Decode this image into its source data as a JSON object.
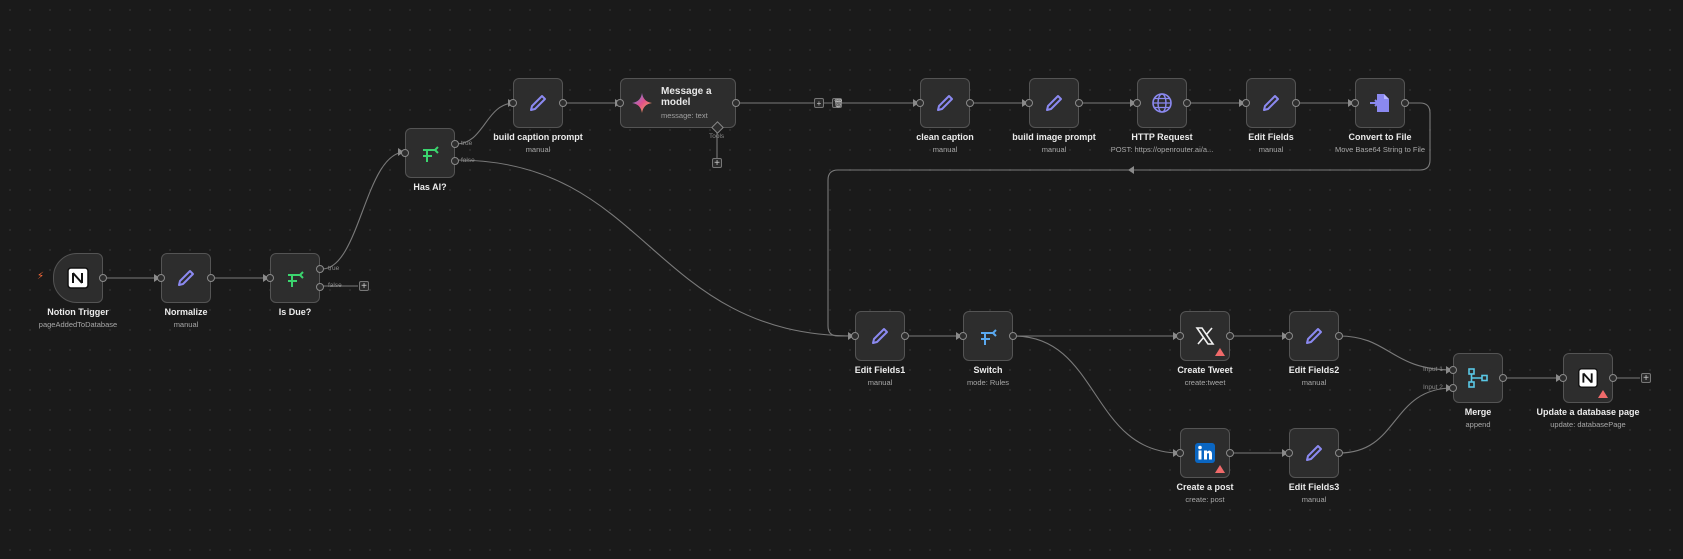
{
  "colors": {
    "background": "#1a1a1a",
    "node_bg": "#2d2d2d",
    "wire": "#7a7a7a",
    "pencil": "#8b89f0",
    "branch_green": "#3bd46e",
    "branch_blue": "#5aa9f0",
    "warning": "#f06a6a",
    "trigger_bolt": "#ff6d3a"
  },
  "nodes": {
    "notion_trigger": {
      "title": "Notion Trigger",
      "subtitle": "pageAddedToDatabase",
      "icon": "notion-icon"
    },
    "normalize": {
      "title": "Normalize",
      "subtitle": "manual",
      "icon": "pencil-icon"
    },
    "is_due": {
      "title": "Is Due?",
      "subtitle": "",
      "icon": "branch-icon",
      "out_true": "true",
      "out_false": "false"
    },
    "has_ai": {
      "title": "Has AI?",
      "subtitle": "",
      "icon": "branch-icon",
      "out_true": "true",
      "out_false": "false"
    },
    "build_caption_prompt": {
      "title": "build caption prompt",
      "subtitle": "manual",
      "icon": "pencil-icon"
    },
    "message_model": {
      "title": "Message a model",
      "subtitle": "message: text",
      "icon": "gemini-icon",
      "tools_label": "Tools"
    },
    "clean_caption": {
      "title": "clean caption",
      "subtitle": "manual",
      "icon": "pencil-icon"
    },
    "build_image_prompt": {
      "title": "build image prompt",
      "subtitle": "manual",
      "icon": "pencil-icon"
    },
    "http_request": {
      "title": "HTTP Request",
      "subtitle": "POST: https://openrouter.ai/a...",
      "icon": "globe-icon"
    },
    "edit_fields": {
      "title": "Edit Fields",
      "subtitle": "manual",
      "icon": "pencil-icon"
    },
    "convert_to_file": {
      "title": "Convert to File",
      "subtitle": "Move Base64 String to File",
      "icon": "file-convert-icon"
    },
    "edit_fields1": {
      "title": "Edit Fields1",
      "subtitle": "manual",
      "icon": "pencil-icon"
    },
    "switch": {
      "title": "Switch",
      "subtitle": "mode: Rules",
      "icon": "switch-icon"
    },
    "create_tweet": {
      "title": "Create Tweet",
      "subtitle": "create:tweet",
      "icon": "x-logo-icon"
    },
    "edit_fields2": {
      "title": "Edit Fields2",
      "subtitle": "manual",
      "icon": "pencil-icon"
    },
    "create_post": {
      "title": "Create a post",
      "subtitle": "create: post",
      "icon": "linkedin-icon"
    },
    "edit_fields3": {
      "title": "Edit Fields3",
      "subtitle": "manual",
      "icon": "pencil-icon"
    },
    "merge": {
      "title": "Merge",
      "subtitle": "append",
      "icon": "merge-icon",
      "in1": "Input 1",
      "in2": "Input 2"
    },
    "update_db_page": {
      "title": "Update a database page",
      "subtitle": "update: databasePage",
      "icon": "notion-icon"
    }
  },
  "controls": {
    "add": "+",
    "delete": "🗑"
  }
}
